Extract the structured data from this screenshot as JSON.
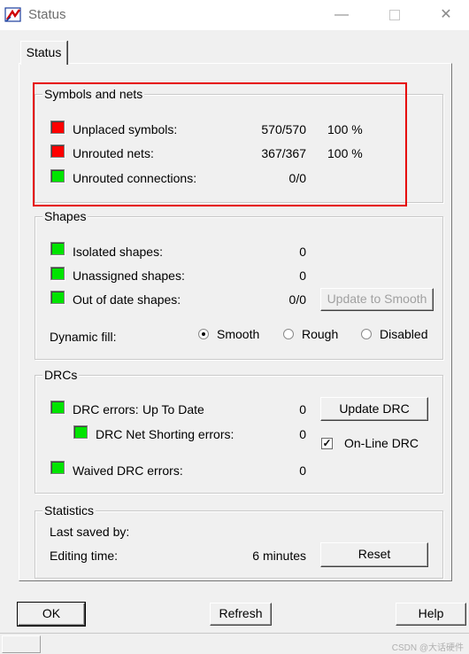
{
  "window": {
    "title": "Status"
  },
  "tabs": [
    "Status"
  ],
  "symbols_nets": {
    "title": "Symbols and nets",
    "rows": [
      {
        "label": "Unplaced symbols:",
        "count": "570/570",
        "percent": "100 %",
        "status": "red"
      },
      {
        "label": "Unrouted nets:",
        "count": "367/367",
        "percent": "100 %",
        "status": "red"
      },
      {
        "label": "Unrouted connections:",
        "count": "0/0",
        "percent": "",
        "status": "green"
      }
    ]
  },
  "shapes": {
    "title": "Shapes",
    "rows": [
      {
        "label": "Isolated shapes:",
        "value": "0"
      },
      {
        "label": "Unassigned shapes:",
        "value": "0"
      },
      {
        "label": "Out of date shapes:",
        "value": "0/0"
      }
    ],
    "update_button": "Update to Smooth",
    "dynamic_fill_label": "Dynamic fill:",
    "radio_options": [
      "Smooth",
      "Rough",
      "Disabled"
    ],
    "selected": "Smooth"
  },
  "drcs": {
    "title": "DRCs",
    "errors_label": "DRC errors:",
    "errors_state": "Up To Date",
    "errors_value": "0",
    "net_shorting_label": "DRC Net Shorting errors:",
    "net_shorting_value": "0",
    "waived_label": "Waived DRC errors:",
    "waived_value": "0",
    "update_button": "Update DRC",
    "online_label": "On-Line DRC",
    "online_checked": true
  },
  "statistics": {
    "title": "Statistics",
    "last_saved_label": "Last saved by:",
    "editing_time_label": "Editing time:",
    "editing_time_value": "6 minutes",
    "reset_button": "Reset"
  },
  "footer": {
    "ok": "OK",
    "refresh": "Refresh",
    "help": "Help"
  },
  "watermark": "CSDN @大话硬件",
  "colors": {
    "led_green": "#00e400",
    "led_red": "#ff0000",
    "highlight": "#e60000"
  }
}
